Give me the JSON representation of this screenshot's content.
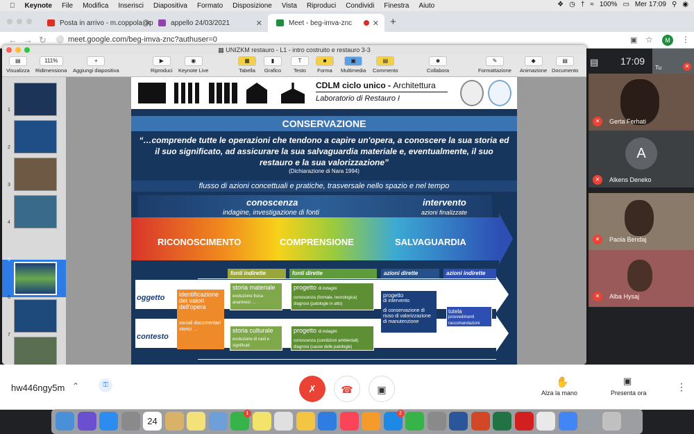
{
  "macos_menubar": {
    "app": "Keynote",
    "menus": [
      "File",
      "Modifica",
      "Inserisci",
      "Diapositiva",
      "Formato",
      "Disposizione",
      "Vista",
      "Riproduci",
      "Condividi",
      "Finestra",
      "Aiuto"
    ],
    "battery": "100%",
    "clock": "Mer 17:09"
  },
  "browser": {
    "tabs": [
      {
        "label": "Posta in arrivo - m.coppola@p",
        "color": "#d93025",
        "active": false
      },
      {
        "label": "appello 24/03/2021",
        "color": "#8e44ad",
        "active": false
      },
      {
        "label": "Meet - beg-imva-znc",
        "color": "#1e8e3e",
        "active": true
      }
    ],
    "new_tab": "+",
    "url": "meet.google.com/beg-imva-znc?authuser=0",
    "profile_initial": "M"
  },
  "keynote": {
    "window_title": "UNIZKM restauro - L1 - intro costruito e restauro 3-3",
    "toolbar": {
      "visualizza": "Visualizza",
      "zoom_value": "111%",
      "ridimensiona": "Ridimensiona",
      "aggiungi": "Aggiungi diapositiva",
      "riproduci": "Riproduci",
      "keynote_live": "Keynote Live",
      "tabella": "Tabella",
      "grafico": "Grafico",
      "testo": "Testo",
      "forma": "Forma",
      "multimedia": "Multimedia",
      "commento": "Commento",
      "collabora": "Collabora",
      "formattazione": "Formattazione",
      "animazione": "Animazione",
      "documento": "Documento"
    },
    "slide_numbers": [
      "1",
      "2",
      "3",
      "4",
      "5",
      "6",
      "7"
    ],
    "selected_slide": "5"
  },
  "slide": {
    "header_title_bold": "CDLM ciclo unico - ",
    "header_title": "Architettura",
    "header_subtitle": "Laboratorio di Restauro I",
    "section_title": "CONSERVAZIONE",
    "quote": "“…comprende tutte le operazioni che tendono a capire un'opera, a conoscere la sua storia ed il suo significato, ad assicurare la sua salvaguardia materiale e, eventualmente, il suo restauro e la sua valorizzazione”",
    "quote_source": "(Dichiarazione di Nara 1994)",
    "flow": "flusso di azioni concettuali e pratiche, trasversale nello spazio e nel tempo",
    "conoscenza": "conoscenza",
    "conoscenza_sub": "indagine, investigazione di fonti",
    "intervento": "intervento",
    "intervento_sub": "azioni finalizzate",
    "phases": [
      "RICONOSCIMENTO",
      "COMPRENSIONE",
      "SALVAGUARDIA"
    ],
    "columns": {
      "fonti_indirette": "fonti indirette",
      "fonti_dirette": "fonti dirette",
      "azioni_dirette": "azioni dirette",
      "azioni_indirette": "azioni indirette"
    },
    "rows": {
      "oggetto": "oggetto",
      "contesto": "contesto"
    },
    "identificazione": "identificazione dei valori dell'opera",
    "valori": "sociali documentari storici …",
    "storia_materiale": "storia materiale",
    "storia_materiale_sub": "evoluzione fisica anamnesi …",
    "progetto1": "progetto",
    "progetto1_tag": "di indagini",
    "progetto1_sub": "conoscenza (formale, tecnologica) diagnosi (patologie in atto)",
    "storia_culturale": "storia culturale",
    "storia_culturale_sub": "evoluzione di ruoli e significati",
    "progetto2": "progetto",
    "progetto2_tag": "di indagini",
    "progetto2_sub": "conoscenza (condizioni ambientali) diagnosi (cause delle patologie)",
    "progetto_intervento": "progetto",
    "progetto_intervento_tag": "di intervento",
    "progetto_intervento_list": "di conservazione di riuso di valorizzazione di manutenzione",
    "tutela": "tutela",
    "tutela_sub": "provvedimenti raccomandazioni"
  },
  "meet": {
    "time": "17:09",
    "self_label": "Tu",
    "participants": [
      {
        "name": "Gerta Ferhati",
        "muted": true,
        "avatar": ""
      },
      {
        "name": "Alkens Deneko",
        "muted": true,
        "avatar": "A"
      },
      {
        "name": "Paola Bendaj",
        "muted": true,
        "avatar": ""
      },
      {
        "name": "Alba Hysaj",
        "muted": true,
        "avatar": ""
      }
    ],
    "meeting_code": "hw446ngy5m",
    "raise_hand": "Alza la mano",
    "present_now": "Presenta ora"
  },
  "dock_icons": [
    "finder-icon",
    "siri-icon",
    "safari-icon",
    "launchpad-icon",
    "calendar-icon",
    "photos-icon",
    "notes-icon",
    "preview-icon",
    "facetime-icon",
    "stickies-icon",
    "chart-icon",
    "photos2-icon",
    "keynote-icon",
    "music-icon",
    "books-icon",
    "appstore-icon",
    "messages-icon",
    "settings-icon",
    "word-icon",
    "powerpoint-icon",
    "excel-icon",
    "acrobat-icon",
    "textedit-icon",
    "chrome-icon",
    "image-capture-icon",
    "trash-icon"
  ],
  "calendar_day": "24",
  "badges": {
    "facetime": "1",
    "appstore": "2"
  }
}
